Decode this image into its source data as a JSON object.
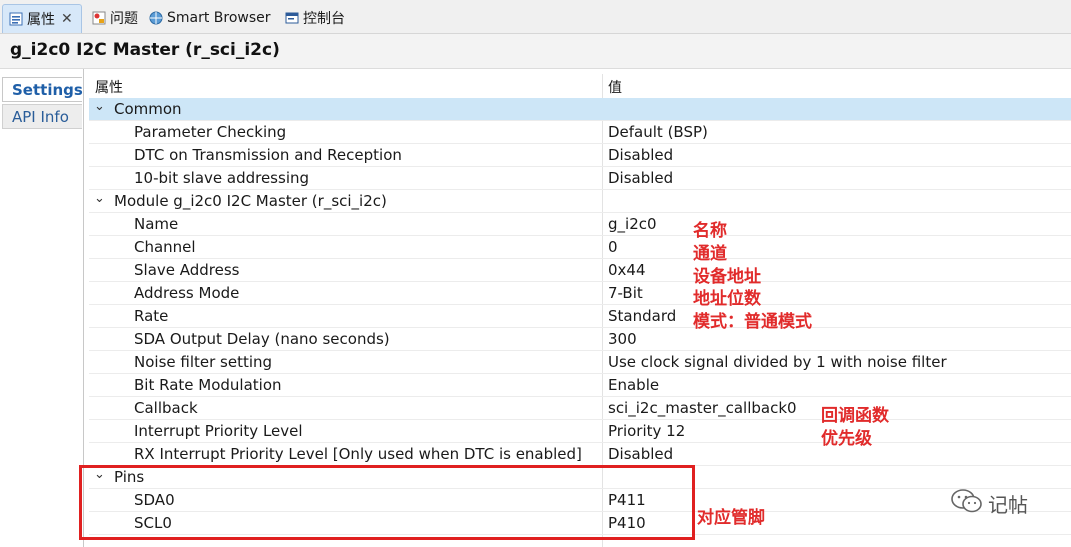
{
  "tabs": [
    {
      "label": "属性",
      "icon": "properties-icon",
      "active": true
    },
    {
      "label": "问题",
      "icon": "problems-icon"
    },
    {
      "label": "Smart Browser",
      "icon": "smart-browser-icon"
    },
    {
      "label": "控制台",
      "icon": "console-icon"
    }
  ],
  "title": "g_i2c0 I2C Master (r_sci_i2c)",
  "side_tabs": [
    "Settings",
    "API Info"
  ],
  "table": {
    "col_property": "属性",
    "col_value": "值",
    "rows": [
      {
        "type": "group",
        "key": "Common",
        "value": ""
      },
      {
        "type": "item",
        "key": "Parameter Checking",
        "value": "Default (BSP)"
      },
      {
        "type": "item",
        "key": "DTC on Transmission and Reception",
        "value": "Disabled"
      },
      {
        "type": "item",
        "key": "10-bit slave addressing",
        "value": "Disabled"
      },
      {
        "type": "group",
        "key": "Module g_i2c0 I2C Master (r_sci_i2c)",
        "value": ""
      },
      {
        "type": "item",
        "key": "Name",
        "value": "g_i2c0"
      },
      {
        "type": "item",
        "key": "Channel",
        "value": "0"
      },
      {
        "type": "item",
        "key": "Slave Address",
        "value": "0x44"
      },
      {
        "type": "item",
        "key": "Address Mode",
        "value": "7-Bit"
      },
      {
        "type": "item",
        "key": "Rate",
        "value": "Standard"
      },
      {
        "type": "item",
        "key": "SDA Output Delay (nano seconds)",
        "value": "300"
      },
      {
        "type": "item",
        "key": "Noise filter setting",
        "value": "Use clock signal divided by 1 with noise filter"
      },
      {
        "type": "item",
        "key": "Bit Rate Modulation",
        "value": "Enable"
      },
      {
        "type": "item",
        "key": "Callback",
        "value": "sci_i2c_master_callback0"
      },
      {
        "type": "item",
        "key": "Interrupt Priority Level",
        "value": "Priority 12"
      },
      {
        "type": "item",
        "key": "RX Interrupt Priority Level [Only used when DTC is enabled]",
        "value": "Disabled"
      },
      {
        "type": "group",
        "key": "Pins",
        "value": ""
      },
      {
        "type": "item",
        "key": "SDA0",
        "value": "P411"
      },
      {
        "type": "item",
        "key": "SCL0",
        "value": "P410"
      }
    ]
  },
  "annotations": {
    "name": "名称",
    "channel": "通道",
    "slave_address": "设备地址",
    "address_mode": "地址位数",
    "rate": "模式：普通模式",
    "callback": "回调函数",
    "priority": "优先级",
    "pins": "对应管脚"
  },
  "watermark": "记帖",
  "colors": {
    "annotation": "#e12b2b",
    "selected_row": "#cde6f7",
    "link": "#1f5fa8"
  }
}
